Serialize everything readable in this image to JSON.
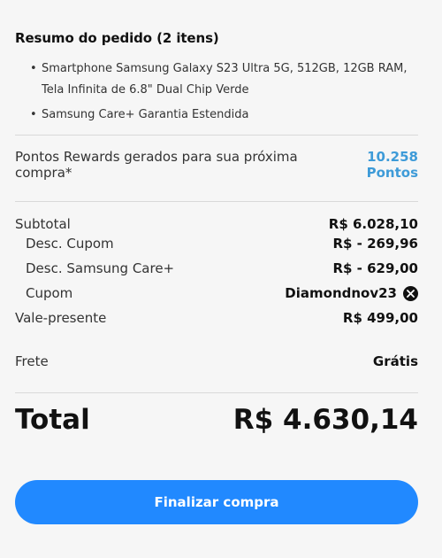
{
  "summary": {
    "title": "Resumo do pedido (2 itens)",
    "items": [
      {
        "label": "Smartphone Samsung Galaxy S23 Ultra 5G, 512GB, 12GB RAM, Tela Infinita de 6.8\" Dual Chip Verde"
      },
      {
        "label": "Samsung Care+ Garantia Estendida"
      }
    ]
  },
  "rewards": {
    "label": "Pontos Rewards gerados para sua próxima compra*",
    "points": "10.258",
    "unit": "Pontos",
    "accent_color": "#3e9bd8"
  },
  "breakdown": {
    "subtotal": {
      "label": "Subtotal",
      "value": "R$ 6.028,10"
    },
    "coupon_discount": {
      "label": "Desc. Cupom",
      "value": "R$ - 269,96"
    },
    "care_discount": {
      "label": "Desc. Samsung Care+",
      "value": "R$ - 629,00"
    },
    "coupon": {
      "label": "Cupom",
      "code": "Diamondnov23",
      "remove_icon": "close-circle-icon"
    },
    "gift_card": {
      "label": "Vale-presente",
      "value": "R$ 499,00"
    },
    "shipping": {
      "label": "Frete",
      "value": "Grátis"
    }
  },
  "total": {
    "label": "Total",
    "value": "R$ 4.630,14"
  },
  "checkout": {
    "label": "Finalizar compra",
    "color": "#2189ff"
  }
}
